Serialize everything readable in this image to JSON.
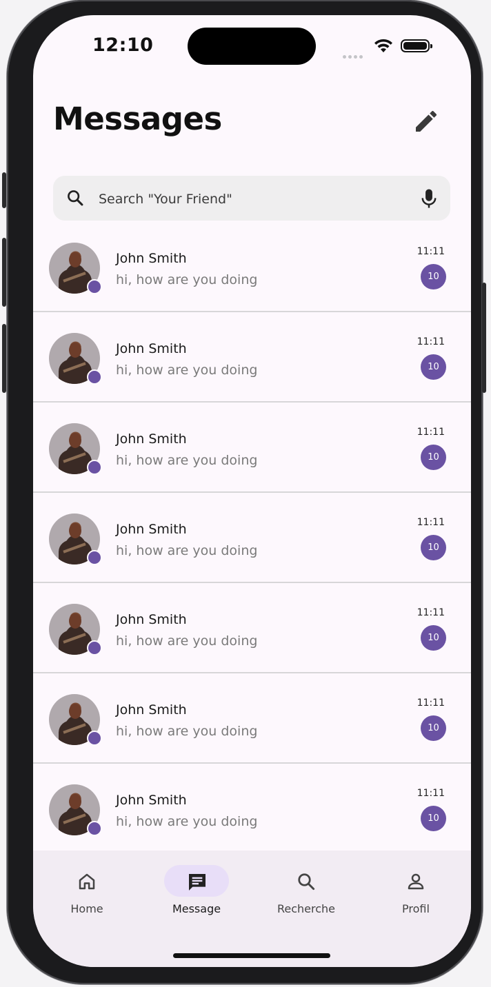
{
  "status_bar": {
    "time": "12:10"
  },
  "header": {
    "title": "Messages"
  },
  "search": {
    "placeholder": "Search \"Your Friend\""
  },
  "conversations": [
    {
      "name": "John Smith",
      "preview": "hi, how are you doing",
      "time": "11:11",
      "unread": "10"
    },
    {
      "name": "John Smith",
      "preview": "hi, how are you doing",
      "time": "11:11",
      "unread": "10"
    },
    {
      "name": "John Smith",
      "preview": "hi, how are you doing",
      "time": "11:11",
      "unread": "10"
    },
    {
      "name": "John Smith",
      "preview": "hi, how are you doing",
      "time": "11:11",
      "unread": "10"
    },
    {
      "name": "John Smith",
      "preview": "hi, how are you doing",
      "time": "11:11",
      "unread": "10"
    },
    {
      "name": "John Smith",
      "preview": "hi, how are you doing",
      "time": "11:11",
      "unread": "10"
    },
    {
      "name": "John Smith",
      "preview": "hi, how are you doing",
      "time": "11:11",
      "unread": "10"
    }
  ],
  "bottom_nav": {
    "items": [
      {
        "label": "Home",
        "icon": "home-icon"
      },
      {
        "label": "Message",
        "icon": "message-icon"
      },
      {
        "label": "Recherche",
        "icon": "search-icon"
      },
      {
        "label": "Profil",
        "icon": "person-icon"
      }
    ],
    "active": "Message"
  },
  "colors": {
    "accent": "#6a52a3",
    "nav_active_pill": "#e8def8",
    "background": "#fdf8fd"
  }
}
